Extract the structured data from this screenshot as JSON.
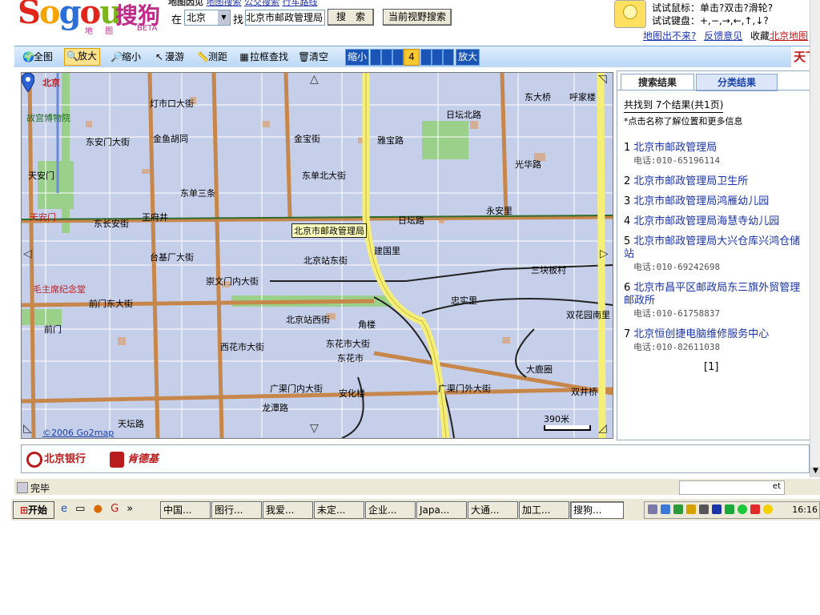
{
  "header": {
    "logo_text": "Sogou",
    "logo_cn": "搜狗",
    "logo_sub": "地 图",
    "logo_beta": "BETA",
    "cut_text": "地图因见",
    "cut_link1": "地图搜索",
    "cut_link2": "公交搜索",
    "cut_link3": "行车路线",
    "city_label": "在",
    "city_value": "北京",
    "find_label": "找",
    "search_value": "北京市邮政管理局",
    "search_button": "搜　索",
    "view_search_button": "当前视野搜索",
    "tip_mouse": "试试鼠标：单击?双击?滑轮?",
    "tip_keyboard": "试试键盘：+,−,→,←,↑,↓?",
    "link_map_fail": "地图出不来?",
    "link_feedback": "反馈意见",
    "link_bookmark_prefix": "收藏",
    "link_bookmark": "北京地图"
  },
  "toolbar": {
    "items": [
      {
        "label": "全图",
        "icon": "globe-icon",
        "glyph": "🌍"
      },
      {
        "label": "放大",
        "icon": "zoom-in-icon",
        "glyph": "🔍"
      },
      {
        "label": "缩小",
        "icon": "zoom-out-icon",
        "glyph": "🔎"
      },
      {
        "label": "漫游",
        "icon": "pointer-icon",
        "glyph": "↖"
      },
      {
        "label": "测距",
        "icon": "ruler-icon",
        "glyph": "📏"
      },
      {
        "label": "拉框查找",
        "icon": "box-search-icon",
        "glyph": "▦"
      },
      {
        "label": "清空",
        "icon": "trash-icon",
        "glyph": "🗑"
      }
    ],
    "zoom_out": "缩小",
    "zoom_level": "4",
    "zoom_in": "放大",
    "brand": "天下"
  },
  "map": {
    "city_badge": "北京",
    "copyright": "©2006 Go2map",
    "scale": "390米",
    "pin_label": "北京市邮政管理局",
    "labels": [
      "故宫博物院",
      "东安门大街",
      "天安门",
      "天安门",
      "毛主席纪念堂",
      "前门",
      "王府井",
      "金鱼胡同",
      "东单三条",
      "台基厂大街",
      "东长安街",
      "前门东大街",
      "灯市口大街",
      "金宝街",
      "雅宝路",
      "日坛北路",
      "东大桥",
      "光华路",
      "永安里",
      "建国里",
      "广渠门内大街",
      "广渠门外大街",
      "东花市",
      "角楼",
      "忠实里",
      "三块板村",
      "双花园南里",
      "大鹿圈",
      "安化楼",
      "西花市大街",
      "东花市大街",
      "日坛路",
      "北京站东街",
      "崇文门内大街",
      "呼家楼",
      "双井桥",
      "龙潭路",
      "天坛路",
      "北京站西街",
      "东单北大街"
    ]
  },
  "results": {
    "tab_results": "搜索结果",
    "tab_category": "分类结果",
    "count_text": "共找到 7个结果(共1页)",
    "note": "*点击名称了解位置和更多信息",
    "items": [
      {
        "num": "1",
        "name": "北京市邮政管理局",
        "tel": "电话:010-65196114"
      },
      {
        "num": "2",
        "name": "北京市邮政管理局卫生所",
        "tel": ""
      },
      {
        "num": "3",
        "name": "北京市邮政管理局鸿雁幼儿园",
        "tel": ""
      },
      {
        "num": "4",
        "name": "北京市邮政管理局海慧寺幼儿园",
        "tel": ""
      },
      {
        "num": "5",
        "name": "北京市邮政管理局大兴仓库兴鸿仓储站",
        "tel": "电话:010-69242698"
      },
      {
        "num": "6",
        "name": "北京市昌平区邮政局东三旗外贸管理邮政所",
        "tel": "电话:010-61758837"
      },
      {
        "num": "7",
        "name": "北京恒创捷电脑维修服务中心",
        "tel": "电话:010-82611038"
      }
    ],
    "pager": "[1]"
  },
  "ads": {
    "ad1": "北京银行",
    "ad2": "肯德基"
  },
  "status": {
    "text": "完毕",
    "right_text": "et"
  },
  "taskbar": {
    "start": "开始",
    "items": [
      "中国...",
      "图行...",
      "我爱...",
      "未定...",
      "企业...",
      "Japa...",
      "大通...",
      "加工...",
      "搜狗..."
    ],
    "clock": "16:16"
  },
  "colors": {
    "map_bg": "#c5cfea",
    "road_main": "#c8874a",
    "road_ring": "#f5ef78",
    "link_blue": "#1a33a8",
    "toolbar_bg": "#c8dff7"
  }
}
